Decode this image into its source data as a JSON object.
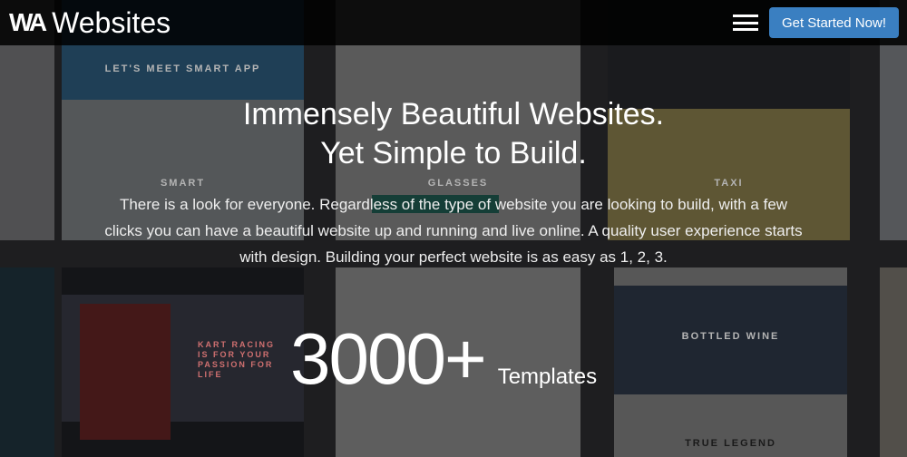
{
  "nav": {
    "logo_mark": "WA",
    "brand": "Websites",
    "menu_icon": "hamburger-icon",
    "cta": "Get Started Now!",
    "cta_color": "#3a7fc1"
  },
  "hero": {
    "title_line1": "Immensely Beautiful Websites.",
    "title_line2": "Yet Simple to Build.",
    "description": "There is a look for everyone. Regardless of the type of website you are looking to build, with a few clicks you can have a beautiful website up and running and live online. A quality user experience starts with design. Building your perfect website is as easy as 1, 2, 3."
  },
  "stat": {
    "number": "3000+",
    "label": "Templates"
  },
  "background_tiles": [
    "LET'S MEET SMART APP",
    "SMART",
    "GLASSES",
    "TAXI",
    "KART RACING IS FOR YOUR PASSION FOR LIFE",
    "BOTTLED WINE",
    "TRUE LEGEND"
  ]
}
